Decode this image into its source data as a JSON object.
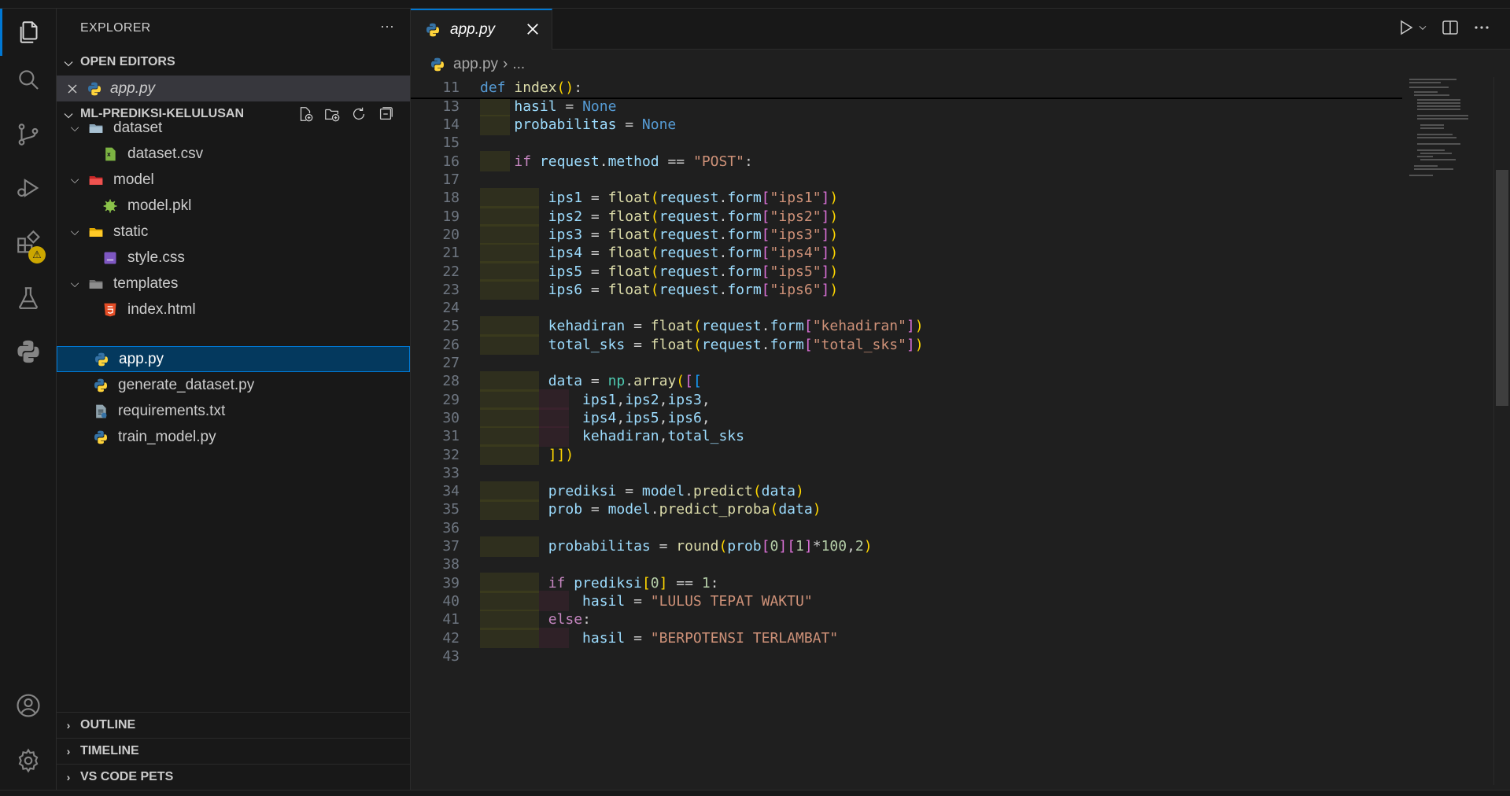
{
  "activity_bar": {
    "items": [
      "explorer-icon",
      "search-icon",
      "source-control-icon",
      "run-debug-icon",
      "extensions-icon",
      "testing-icon",
      "python-icon"
    ],
    "extensions_badge": "⚠",
    "bottom": [
      "account-icon",
      "manage-gear-icon"
    ]
  },
  "sidebar": {
    "title": "EXPLORER",
    "more": "···",
    "open_editors": {
      "header": "OPEN EDITORS",
      "files": [
        {
          "name": "app.py",
          "icon": "python-icon"
        }
      ]
    },
    "project": {
      "header": "ML-PREDIKSI-KELULUSAN",
      "tree": [
        {
          "name": "dataset",
          "type": "folder",
          "icon": "folder-icon"
        },
        {
          "name": "dataset.csv",
          "type": "file",
          "icon": "csv-file-icon"
        },
        {
          "name": "model",
          "type": "folder",
          "icon": "model-folder-icon"
        },
        {
          "name": "model.pkl",
          "type": "file",
          "icon": "pickle-file-icon"
        },
        {
          "name": "static",
          "type": "folder",
          "icon": "static-folder-icon"
        },
        {
          "name": "style.css",
          "type": "file",
          "icon": "css-file-icon"
        },
        {
          "name": "templates",
          "type": "folder",
          "icon": "templates-folder-icon"
        },
        {
          "name": "index.html",
          "type": "file",
          "icon": "html-file-icon"
        },
        {
          "name": "app.py",
          "type": "file",
          "icon": "python-icon"
        },
        {
          "name": "generate_dataset.py",
          "type": "file",
          "icon": "python-icon"
        },
        {
          "name": "requirements.txt",
          "type": "file",
          "icon": "requirements-file-icon"
        },
        {
          "name": "train_model.py",
          "type": "file",
          "icon": "python-icon"
        }
      ]
    },
    "bottom_sections": [
      "OUTLINE",
      "TIMELINE",
      "VS CODE PETS"
    ]
  },
  "editor": {
    "tab_label": "app.py",
    "breadcrumb_file": "app.py",
    "breadcrumb_more": "...",
    "sticky_line": {
      "num": "11",
      "text": "def index():"
    },
    "lines": [
      {
        "num": "13",
        "text": "    hasil = None"
      },
      {
        "num": "14",
        "text": "    probabilitas = None"
      },
      {
        "num": "15",
        "text": ""
      },
      {
        "num": "16",
        "text": "    if request.method == \"POST\":"
      },
      {
        "num": "17",
        "text": ""
      },
      {
        "num": "18",
        "text": "        ips1 = float(request.form[\"ips1\"])"
      },
      {
        "num": "19",
        "text": "        ips2 = float(request.form[\"ips2\"])"
      },
      {
        "num": "20",
        "text": "        ips3 = float(request.form[\"ips3\"])"
      },
      {
        "num": "21",
        "text": "        ips4 = float(request.form[\"ips4\"])"
      },
      {
        "num": "22",
        "text": "        ips5 = float(request.form[\"ips5\"])"
      },
      {
        "num": "23",
        "text": "        ips6 = float(request.form[\"ips6\"])"
      },
      {
        "num": "24",
        "text": ""
      },
      {
        "num": "25",
        "text": "        kehadiran = float(request.form[\"kehadiran\"])"
      },
      {
        "num": "26",
        "text": "        total_sks = float(request.form[\"total_sks\"])"
      },
      {
        "num": "27",
        "text": ""
      },
      {
        "num": "28",
        "text": "        data = np.array([["
      },
      {
        "num": "29",
        "text": "            ips1,ips2,ips3,"
      },
      {
        "num": "30",
        "text": "            ips4,ips5,ips6,"
      },
      {
        "num": "31",
        "text": "            kehadiran,total_sks"
      },
      {
        "num": "32",
        "text": "        ]])"
      },
      {
        "num": "33",
        "text": ""
      },
      {
        "num": "34",
        "text": "        prediksi = model.predict(data)"
      },
      {
        "num": "35",
        "text": "        prob = model.predict_proba(data)"
      },
      {
        "num": "36",
        "text": ""
      },
      {
        "num": "37",
        "text": "        probabilitas = round(prob[0][1]*100,2)"
      },
      {
        "num": "38",
        "text": ""
      },
      {
        "num": "39",
        "text": "        if prediksi[0] == 1:"
      },
      {
        "num": "40",
        "text": "            hasil = \"LULUS TEPAT WAKTU\""
      },
      {
        "num": "41",
        "text": "        else:"
      },
      {
        "num": "42",
        "text": "            hasil = \"BERPOTENSI TERLAMBAT\""
      },
      {
        "num": "43",
        "text": ""
      }
    ]
  },
  "colors": {
    "accent": "#0078d4",
    "keyword": "#569cd6",
    "control": "#c586c0",
    "function": "#dcdcaa",
    "string": "#ce9178",
    "variable": "#9cdcfe",
    "class": "#4ec9b0",
    "number": "#b5cea8"
  }
}
